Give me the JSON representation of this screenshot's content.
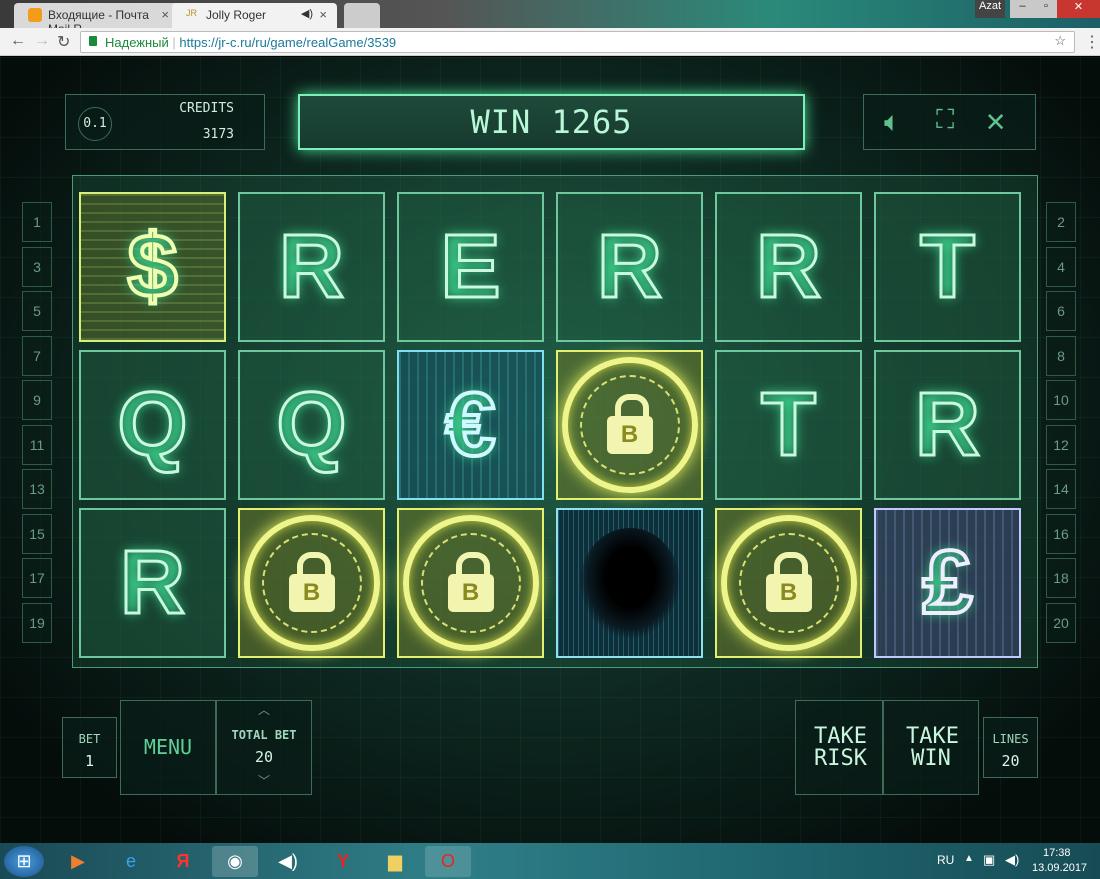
{
  "browser": {
    "tabs": [
      {
        "label": "Входящие - Почта Mail.R"
      },
      {
        "label": "Jolly Roger",
        "audio": "speaker-icon"
      }
    ],
    "user": "Azat",
    "secure_label": "Надежный",
    "url": "https://jr-c.ru/ru/game/realGame/3539"
  },
  "game": {
    "denomination": "0.1",
    "credits_label": "CREDITS",
    "credits_value": "3173",
    "win_text": "WIN 1265",
    "reels": [
      [
        "$",
        "R",
        "E",
        "R",
        "R",
        "T"
      ],
      [
        "Q",
        "Q",
        "€",
        "lock",
        "T",
        "R"
      ],
      [
        "R",
        "lock",
        "lock",
        "hacker",
        "lock",
        "£"
      ]
    ],
    "lock_letter": "B",
    "lines_left": [
      "1",
      "3",
      "5",
      "7",
      "9",
      "11",
      "13",
      "15",
      "17",
      "19"
    ],
    "lines_right": [
      "2",
      "4",
      "6",
      "8",
      "10",
      "12",
      "14",
      "16",
      "18",
      "20"
    ],
    "bet_label": "BET",
    "bet_value": "1",
    "menu_label": "MENU",
    "total_bet_label": "TOTAL BET",
    "total_bet_value": "20",
    "take_risk_label": "TAKE RISK",
    "take_win_label": "TAKE WIN",
    "lines_label": "LINES",
    "lines_value": "20"
  },
  "taskbar": {
    "lang": "RU",
    "time": "17:38",
    "date": "13.09.2017"
  }
}
